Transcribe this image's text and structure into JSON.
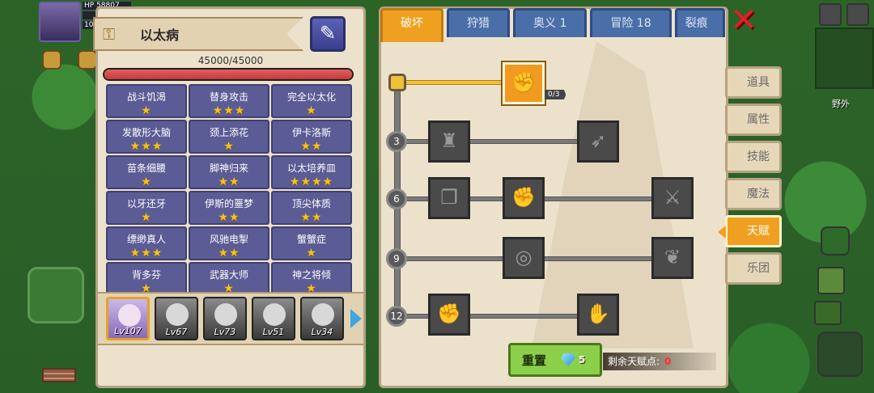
{
  "hud": {
    "hp_value": "58807",
    "level_value": "10",
    "hp_label": "HP",
    "map_label": "野外"
  },
  "panel_left": {
    "title": "以太病",
    "hp_text": "45000/45000",
    "hp_fraction": 1.0,
    "traits": [
      {
        "name": "战斗饥渴",
        "stars": 1
      },
      {
        "name": "替身攻击",
        "stars": 3
      },
      {
        "name": "完全以太化",
        "stars": 1
      },
      {
        "name": "发散形大脑",
        "stars": 3
      },
      {
        "name": "颈上添花",
        "stars": 1
      },
      {
        "name": "伊卡洛斯",
        "stars": 2
      },
      {
        "name": "苗条细腰",
        "stars": 1
      },
      {
        "name": "脚神归来",
        "stars": 2
      },
      {
        "name": "以太培养皿",
        "stars": 4
      },
      {
        "name": "以牙还牙",
        "stars": 1
      },
      {
        "name": "伊斯的噩梦",
        "stars": 2
      },
      {
        "name": "顶尖体质",
        "stars": 2
      },
      {
        "name": "缥缈真人",
        "stars": 3
      },
      {
        "name": "风驰电掣",
        "stars": 2
      },
      {
        "name": "蟹蟹症",
        "stars": 1
      },
      {
        "name": "背多芬",
        "stars": 1
      },
      {
        "name": "武器大师",
        "stars": 1
      },
      {
        "name": "神之将倾",
        "stars": 1
      }
    ],
    "roster": [
      {
        "level": "Lv107",
        "selected": true
      },
      {
        "level": "Lv67",
        "selected": false
      },
      {
        "level": "Lv73",
        "selected": false
      },
      {
        "level": "Lv51",
        "selected": false
      },
      {
        "level": "Lv34",
        "selected": false
      }
    ]
  },
  "tabs": [
    "破坏",
    "狩猎",
    "奥义 1",
    "冒险 18",
    "裂痕"
  ],
  "tree": {
    "tiers": [
      "3",
      "6",
      "9",
      "12"
    ],
    "root_node_count": "0/3",
    "node_icons": [
      "handshake-icon",
      "torso-icon",
      "arrow-icon",
      "scroll-icon",
      "fist-icon",
      "sword-icon",
      "ring-icon",
      "wing-icon",
      "punch-icon",
      "gauntlet-icon"
    ]
  },
  "reset": {
    "label": "重置",
    "gem_count": "5"
  },
  "points": {
    "label": "剩余天赋点:",
    "value": "0"
  },
  "sidenav": [
    "道具",
    "属性",
    "技能",
    "魔法",
    "天赋",
    "乐团"
  ],
  "colors": {
    "accent": "#f0a020",
    "trait_bg": "#5b5c95",
    "star": "#f5c21a",
    "tab_blue": "#4a6fa8"
  }
}
